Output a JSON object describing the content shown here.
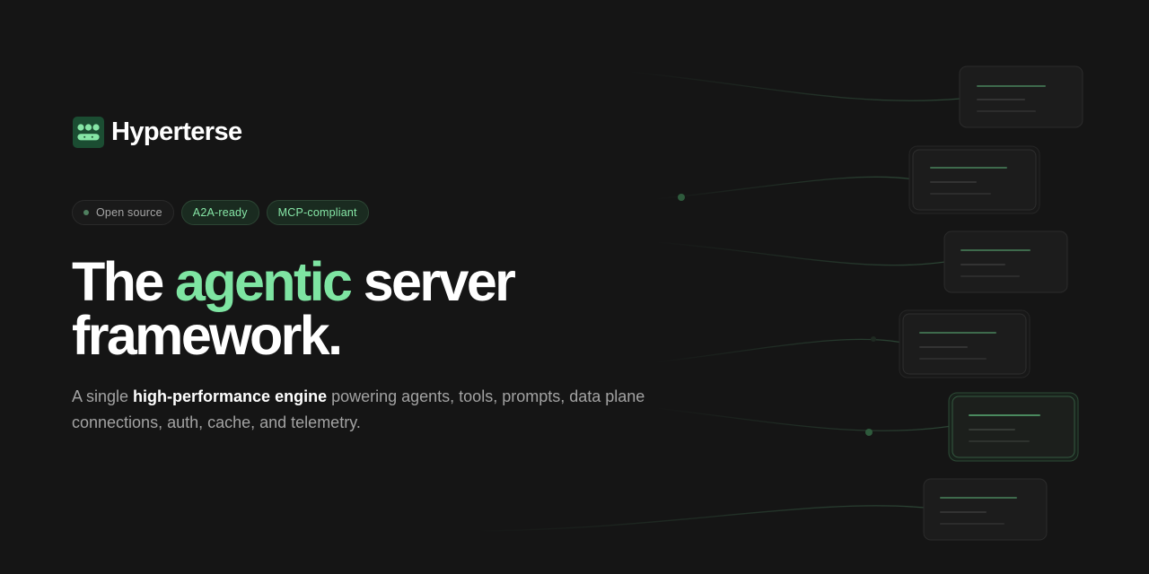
{
  "brand": {
    "name": "Hyperterse",
    "icon": "grid-dots-logo-icon",
    "icon_bg": "#1b4d32",
    "icon_fg": "#86e6a6"
  },
  "badges": [
    {
      "label": "Open source",
      "style": "neutral",
      "dot": true
    },
    {
      "label": "A2A-ready",
      "style": "green"
    },
    {
      "label": "MCP-compliant",
      "style": "green"
    }
  ],
  "headline": {
    "prefix": "The ",
    "accent": "agentic",
    "suffix": " server",
    "line2": "framework."
  },
  "subtitle": {
    "lead": "A single ",
    "bold": "high-performance engine",
    "rest": " powering agents, tools, prompts, data plane connections, auth, cache, and telemetry."
  },
  "colors": {
    "background": "#151515",
    "accent": "#7ee4a2",
    "badge_green_text": "#86e6a6",
    "text_muted": "#a3a3a3"
  }
}
